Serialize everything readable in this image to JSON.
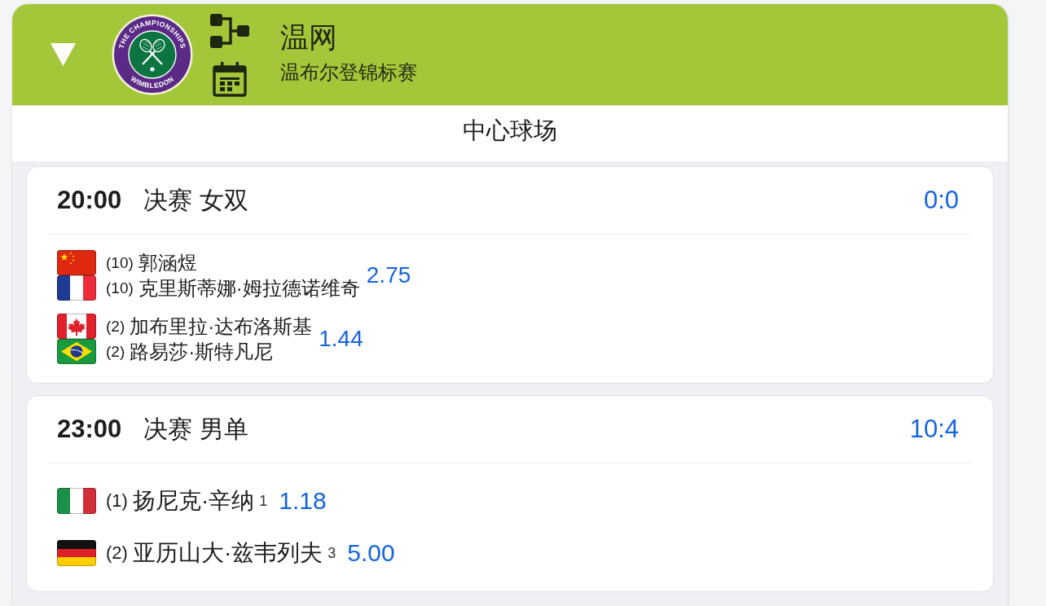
{
  "header": {
    "expanded": true,
    "logo": {
      "top_text": "THE CHAMPIONSHIPS",
      "bottom_text": "WIMBLEDON"
    },
    "title": "温网",
    "subtitle": "温布尔登锦标赛"
  },
  "venue": "中心球场",
  "matches": [
    {
      "kind": "doubles",
      "time": "20:00",
      "title": "决赛 女双",
      "score": "0:0",
      "sides": [
        {
          "players": [
            {
              "kind": "china",
              "seed": "(10)",
              "name": "郭涵煜"
            },
            {
              "kind": "france",
              "seed": "(10)",
              "name": "克里斯蒂娜·姆拉德诺维奇"
            }
          ],
          "odds": "2.75"
        },
        {
          "players": [
            {
              "kind": "canada",
              "seed": "(2)",
              "name": "加布里拉·达布洛斯基"
            },
            {
              "kind": "brazil",
              "seed": "(2)",
              "name": "路易莎·斯特凡尼"
            }
          ],
          "odds": "1.44"
        }
      ]
    },
    {
      "kind": "singles",
      "time": "23:00",
      "title": "决赛 男单",
      "score": "10:4",
      "sides": [
        {
          "players": [
            {
              "kind": "italy",
              "seed": "(1)",
              "name": "扬尼克·辛纳"
            }
          ],
          "sets": "1",
          "odds": "1.18"
        },
        {
          "players": [
            {
              "kind": "germany",
              "seed": "(2)",
              "name": "亚历山大·兹韦列夫"
            }
          ],
          "sets": "3",
          "odds": "5.00"
        }
      ]
    }
  ]
}
